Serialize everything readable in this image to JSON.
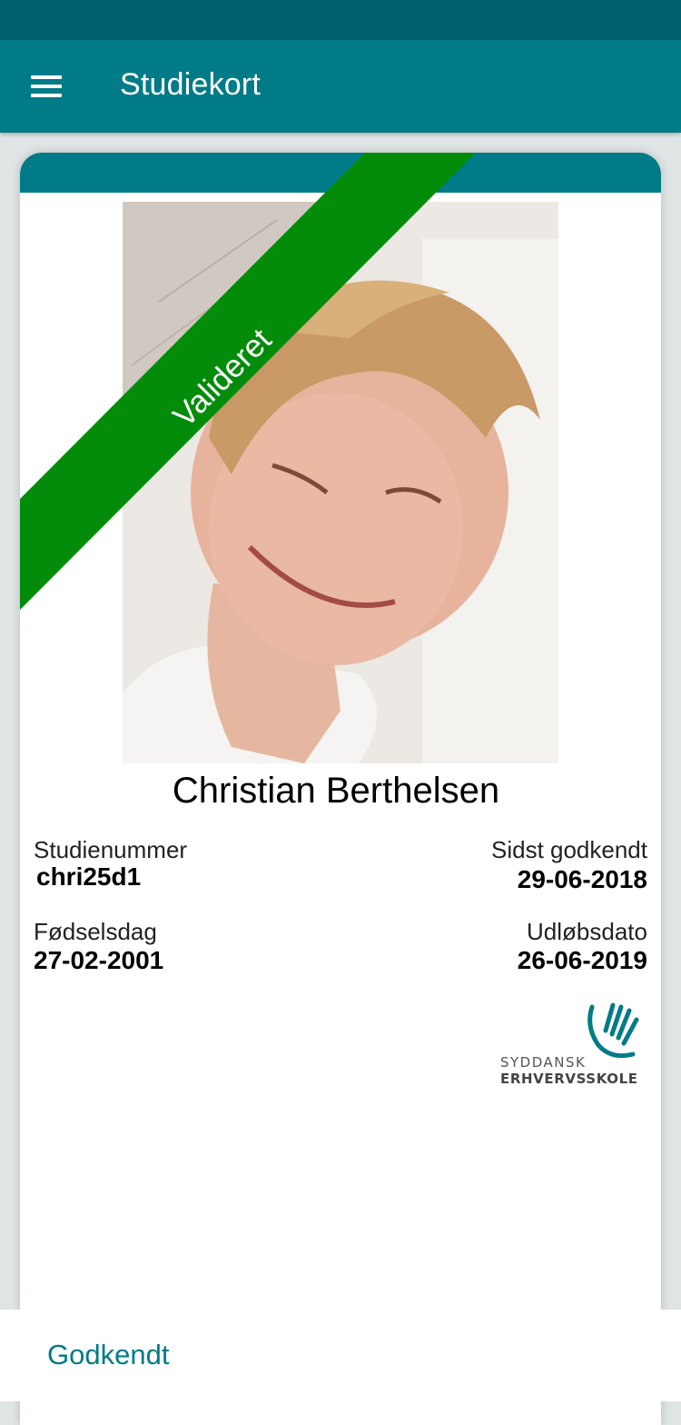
{
  "app_bar": {
    "menu_icon": "hamburger-menu-icon",
    "title": "Studiekort"
  },
  "card": {
    "status_ribbon": "Valideret",
    "status_color": "#038c0a",
    "accent_color": "#007b87",
    "student_name": "Christian Berthelsen",
    "fields": {
      "student_number_label": "Studienummer",
      "student_number": "chri25d1",
      "last_approved_label": "Sidst godkendt",
      "last_approved": "29-06-2018",
      "birthday_label": "Fødselsdag",
      "birthday": "27-02-2001",
      "expiry_label": "Udløbsdato",
      "expiry": "26-06-2019"
    },
    "school_logo": {
      "icon": "hand-logo-icon",
      "line1": "SYDDANSK",
      "line2": "ERHVERVSSKOLE"
    }
  },
  "bottom_bar": {
    "approve_label": "Godkendt"
  }
}
